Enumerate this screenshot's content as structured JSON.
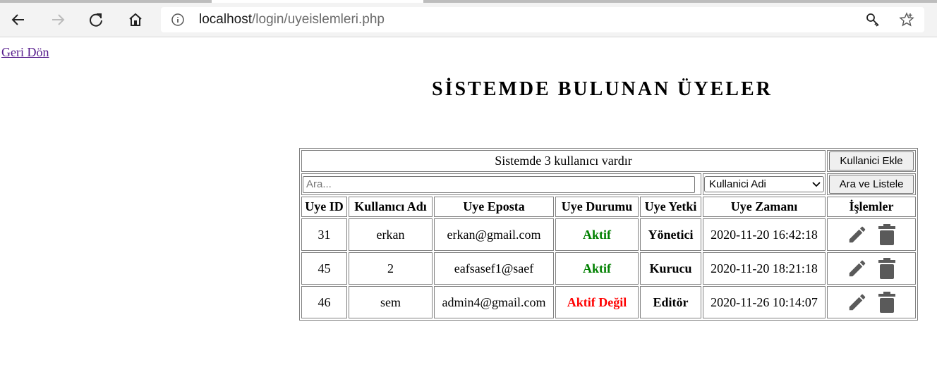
{
  "browser": {
    "url_host": "localhost",
    "url_path": "/login/uyeislemleri.php"
  },
  "page": {
    "back_link": "Geri Dön",
    "title": "SİSTEMDE BULUNAN ÜYELER"
  },
  "table": {
    "summary": "Sistemde 3 kullanıcı vardır",
    "add_button": "Kullanici Ekle",
    "search_placeholder": "Ara...",
    "search_field_selected": "Kullanici Adi",
    "search_button": "Ara ve Listele",
    "headers": [
      "Uye ID",
      "Kullanıcı Adı",
      "Uye Eposta",
      "Uye Durumu",
      "Uye Yetki",
      "Uye Zamanı",
      "İşlemler"
    ],
    "rows": [
      {
        "id": "31",
        "username": "erkan",
        "email": "erkan@gmail.com",
        "status": "Aktif",
        "status_color": "#008000",
        "role": "Yönetici",
        "date": "2020-11-20 16:42:18"
      },
      {
        "id": "45",
        "username": "2",
        "email": "eafsasef1@saef",
        "status": "Aktif",
        "status_color": "#008000",
        "role": "Kurucu",
        "date": "2020-11-20 18:21:18"
      },
      {
        "id": "46",
        "username": "sem",
        "email": "admin4@gmail.com",
        "status": "Aktif Değil",
        "status_color": "#ff0000",
        "role": "Editör",
        "date": "2020-11-26 10:14:07"
      }
    ],
    "row_icons": [
      "pencil-icon",
      "trash-icon"
    ]
  }
}
